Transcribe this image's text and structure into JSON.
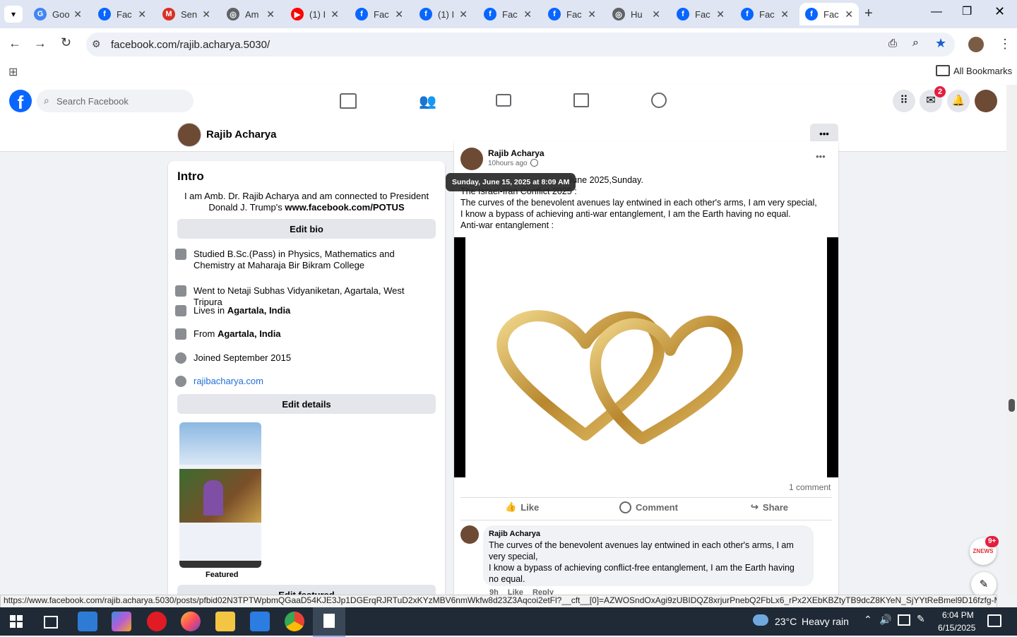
{
  "browser": {
    "tabs": [
      {
        "label": "Goo",
        "icon": "google-icon"
      },
      {
        "label": "Fac",
        "icon": "facebook-icon"
      },
      {
        "label": "Sen",
        "icon": "gmail-icon"
      },
      {
        "label": "Am",
        "icon": "globe-icon"
      },
      {
        "label": "(1) I",
        "icon": "youtube-icon"
      },
      {
        "label": "Fac",
        "icon": "facebook-icon"
      },
      {
        "label": "(1) I",
        "icon": "facebook-icon"
      },
      {
        "label": "Fac",
        "icon": "facebook-icon"
      },
      {
        "label": "Fac",
        "icon": "facebook-icon"
      },
      {
        "label": "Hu",
        "icon": "globe-icon"
      },
      {
        "label": "Fac",
        "icon": "facebook-icon"
      },
      {
        "label": "Fac",
        "icon": "facebook-icon"
      },
      {
        "label": "Fac",
        "icon": "facebook-icon"
      }
    ],
    "url": "facebook.com/rajib.acharya.5030/",
    "bookmarks_label": "All Bookmarks"
  },
  "fb": {
    "search_placeholder": "Search Facebook",
    "messenger_badge": "2",
    "profile_name": "Rajib Acharya"
  },
  "intro": {
    "title": "Intro",
    "bio": "I am Amb. Dr. Rajib Acharya and am connected to President Donald J. Trump's",
    "bio_link": "www.facebook.com/POTUS",
    "edit_bio": "Edit bio",
    "details": [
      {
        "icon": "graduation-cap-icon",
        "text": "Studied B.Sc.(Pass) in Physics, Mathematics and Chemistry at Maharaja Bir Bikram College"
      },
      {
        "icon": "graduation-cap-icon",
        "text": "Went to Netaji Subhas Vidyaniketan, Agartala, West Tripura"
      },
      {
        "icon": "home-icon",
        "text": "Lives in ",
        "bold": "Agartala, India"
      },
      {
        "icon": "location-pin-icon",
        "text": "From ",
        "bold": "Agartala, India"
      },
      {
        "icon": "clock-icon",
        "text": "Joined September 2015"
      },
      {
        "icon": "globe-icon",
        "link": "rajibacharya.com"
      }
    ],
    "edit_details": "Edit details",
    "featured_label": "Featured",
    "edit_featured": "Edit featured"
  },
  "post": {
    "author": "Rajib Acharya",
    "time": "10hours ago ·",
    "tooltip": "Sunday, June 15, 2025 at 8:09 AM",
    "lines": [
      "June 2025,Sunday.",
      "The Israel-Iran Conflict 2025 :",
      "The curves of the benevolent avenues lay entwined in each other's arms, I am very special,",
      "I know a bypass of achieving anti-war entanglement, I am the Earth having no equal.",
      "Anti-war entanglement :"
    ],
    "comment_count": "1 comment",
    "actions": {
      "like": "Like",
      "comment": "Comment",
      "share": "Share"
    },
    "comment": {
      "author": "Rajib Acharya",
      "text": "The curves of the benevolent avenues lay entwined in each other's arms, I am very special,\nI know a bypass of achieving conflict-free entanglement, I am the Earth having no equal.",
      "meta_time": "9h",
      "meta_like": "Like",
      "meta_reply": "Reply"
    }
  },
  "chat_badge": "9+",
  "chat_label": "ZNEWS",
  "status_url": "https://www.facebook.com/rajib.acharya.5030/posts/pfbid02N3TPTWpbmQGaaD54KJE3Jp1DGErqRJRTuD2xKYzMBV6nmWkfw8d23Z3Aqcoi2etFl?__cft__[0]=AZWOSndOxAgi9zUBIDQZ8xrjurPnebQ2FbLx6_rPx2XEbKBZtyTB9dcZ8KYeN_SjYYtReBmel9D16fzfg-MdOvZ...",
  "taskbar": {
    "weather_temp": "23°C",
    "weather_text": "Heavy rain",
    "time": "6:04 PM",
    "date": "6/15/2025"
  },
  "colors": {
    "fb_blue": "#0866ff",
    "link_blue": "#216fdb",
    "gold": "#c9a24a"
  }
}
